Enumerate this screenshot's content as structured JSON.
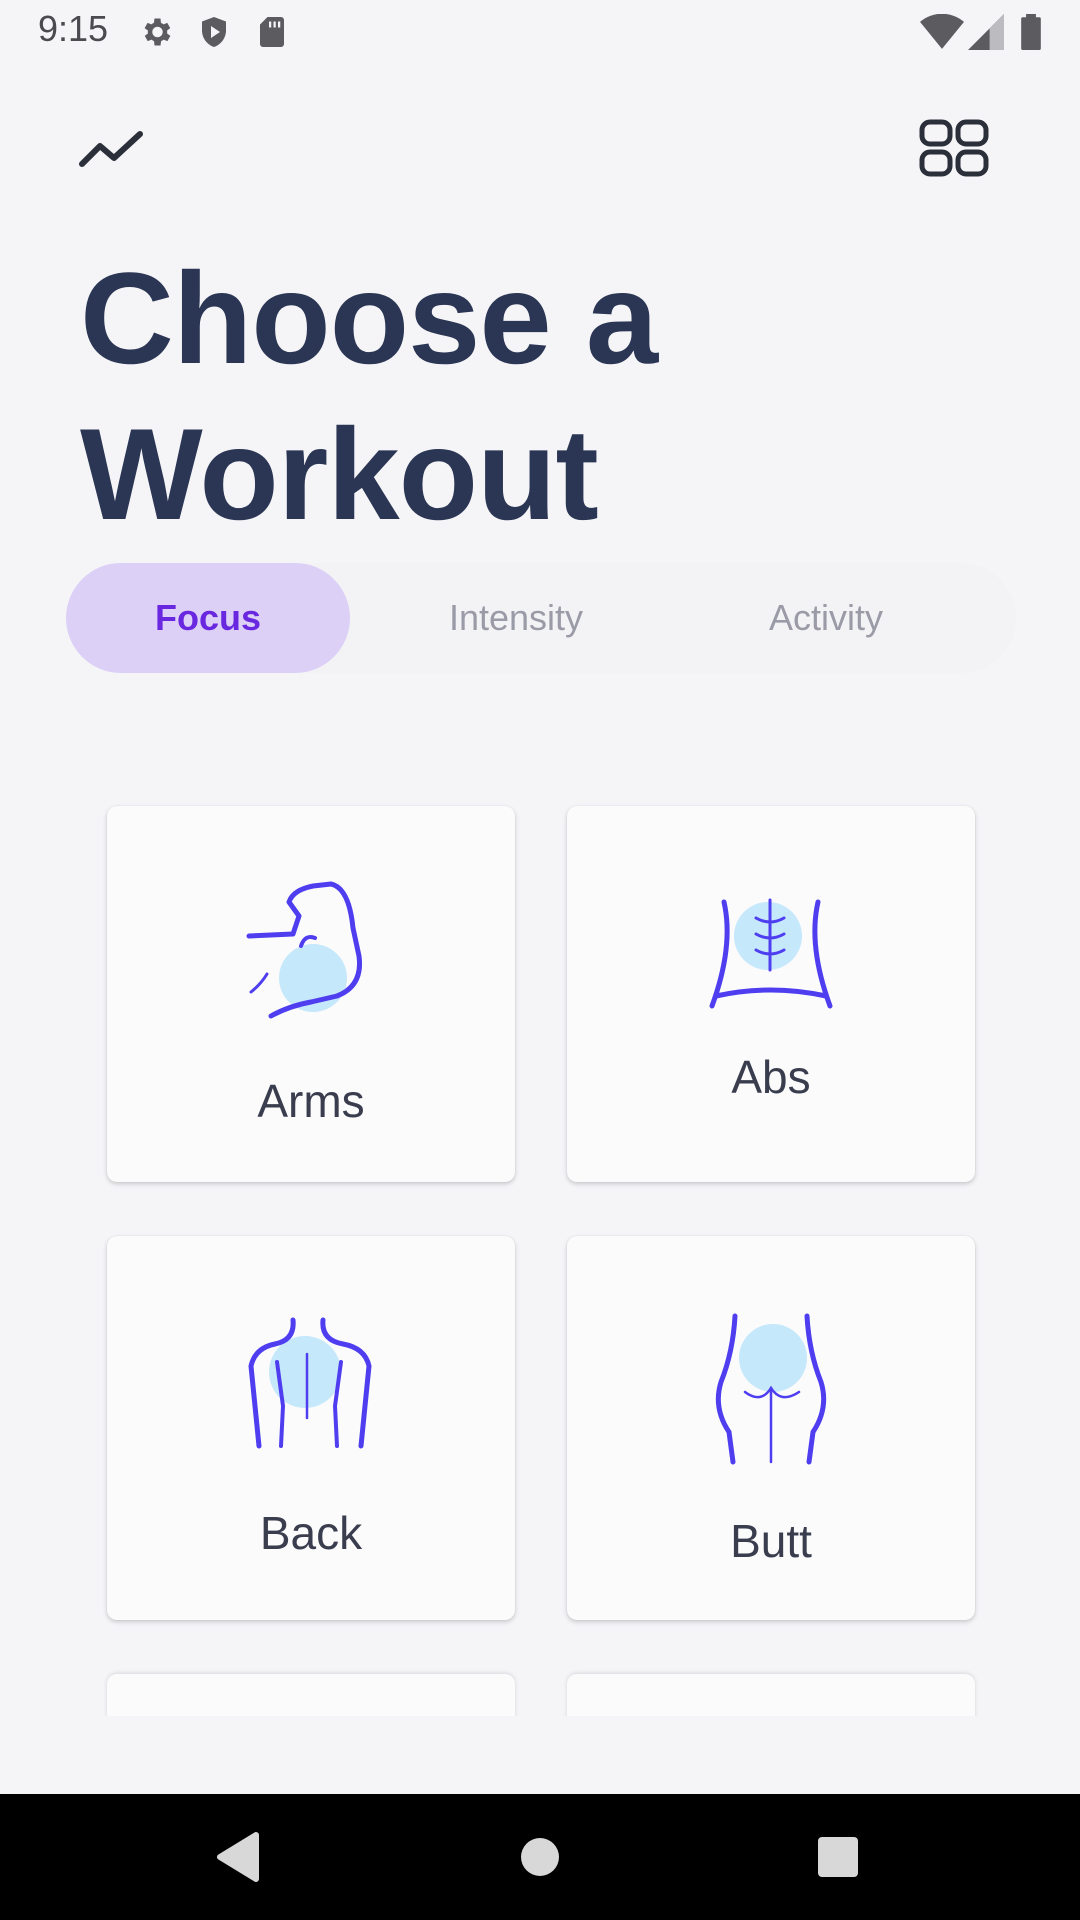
{
  "status_bar": {
    "time": "9:15",
    "left_icons": [
      "gear-icon",
      "shield-play-icon",
      "sd-card-icon"
    ],
    "right_icons": [
      "wifi-icon",
      "signal-icon",
      "battery-icon"
    ]
  },
  "toolbar": {
    "left_icon": "trend-chart-icon",
    "right_icon": "grid-menu-icon"
  },
  "title": {
    "line1": "Choose a",
    "line2": "Workout"
  },
  "tabs": [
    {
      "label": "Focus",
      "active": true
    },
    {
      "label": "Intensity",
      "active": false
    },
    {
      "label": "Activity",
      "active": false
    }
  ],
  "categories": [
    {
      "label": "Arms",
      "icon": "arm-muscle-icon"
    },
    {
      "label": "Abs",
      "icon": "abs-icon"
    },
    {
      "label": "Back",
      "icon": "back-icon"
    },
    {
      "label": "Butt",
      "icon": "butt-icon"
    }
  ],
  "colors": {
    "accent": "#6a27e0",
    "tab_active_bg": "#dcd0f7",
    "title": "#2b3654",
    "icon_stroke": "#4f3ef0",
    "icon_fill": "#c5e8fb"
  },
  "nav_bar": {
    "buttons": [
      "back-icon",
      "home-icon",
      "recents-icon"
    ]
  }
}
